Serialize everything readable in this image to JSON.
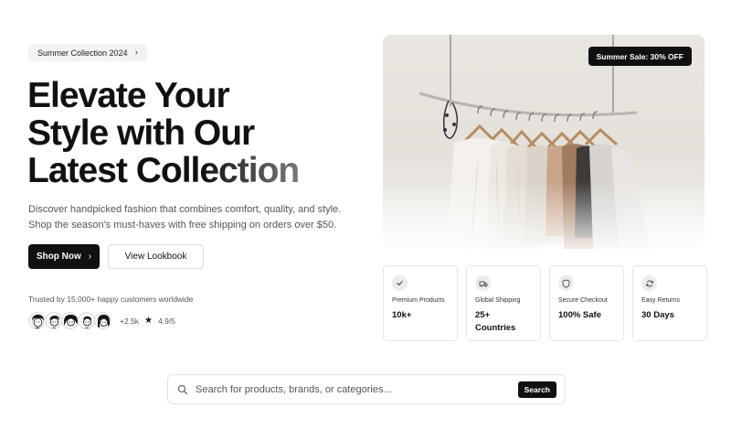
{
  "badge": {
    "label": "Summer Collection 2024",
    "icon": "chevron-right-icon"
  },
  "hero": {
    "headline_line1": "Elevate Your",
    "headline_line2": "Style with Our",
    "headline_line3_a": "Latest ",
    "headline_line3_b": "Collection",
    "description": "Discover handpicked fashion that combines comfort, quality, and style. Shop the season's must-haves with free shipping on orders over $50.",
    "primary_button": "Shop Now",
    "secondary_button": "View Lookbook",
    "image_badge": "Summer Sale: 30% OFF"
  },
  "social_proof": {
    "trusted_text": "Trusted by 15,000+ happy customers worldwide",
    "customer_count": "+2.5k",
    "rating": "4.9/5",
    "avatars": [
      "avatar-1",
      "avatar-2",
      "avatar-3",
      "avatar-4",
      "avatar-5"
    ]
  },
  "features": [
    {
      "label": "Premium Products",
      "value": "10k+",
      "icon": "check-icon"
    },
    {
      "label": "Global Shipping",
      "value": "25+ Countries",
      "icon": "truck-icon"
    },
    {
      "label": "Secure Checkout",
      "value": "100% Safe",
      "icon": "shield-icon"
    },
    {
      "label": "Easy Returns",
      "value": "30 Days",
      "icon": "refresh-icon"
    }
  ],
  "search": {
    "placeholder": "Search for products, brands, or categories...",
    "button": "Search"
  },
  "colors": {
    "primary": "#111111",
    "muted_text": "#555555",
    "border": "#e6e6e6",
    "pill_bg": "#f3f3f3"
  }
}
